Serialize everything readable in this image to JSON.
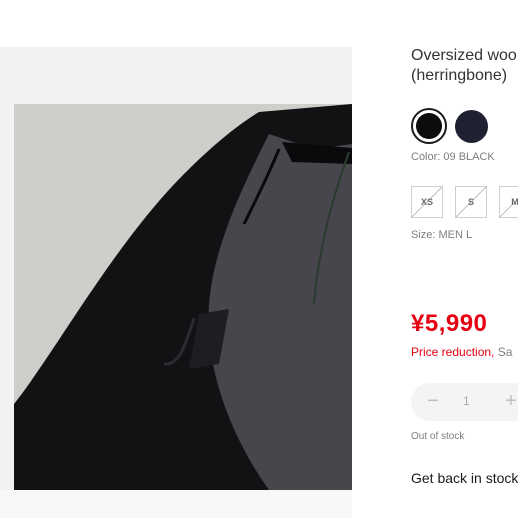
{
  "product": {
    "title_line1": "Oversized woo",
    "title_line2": "(herringbone)",
    "image_alt": "Black oversized wool jacket close-up",
    "colors": [
      {
        "name": "black",
        "hex": "#0c0c0c",
        "selected": true
      },
      {
        "name": "navy",
        "hex": "#1f2130",
        "selected": false
      }
    ],
    "color_label": "Color: 09 BLACK",
    "sizes": [
      {
        "label": "XS",
        "available": false
      },
      {
        "label": "S",
        "available": false
      },
      {
        "label": "M",
        "available": false
      }
    ],
    "size_label": "Size: MEN L",
    "price": "¥5,990",
    "price_reduction": "Price reduction,",
    "price_reduction_rest": "Sa",
    "quantity": {
      "minus": "−",
      "value": "1",
      "plus": "+"
    },
    "stock_status": "Out of stock",
    "back_in_stock": "Get back in stock"
  },
  "theme": {
    "accent": "#e60012",
    "text": "#1b1b1b",
    "muted": "#7d7d7d"
  }
}
